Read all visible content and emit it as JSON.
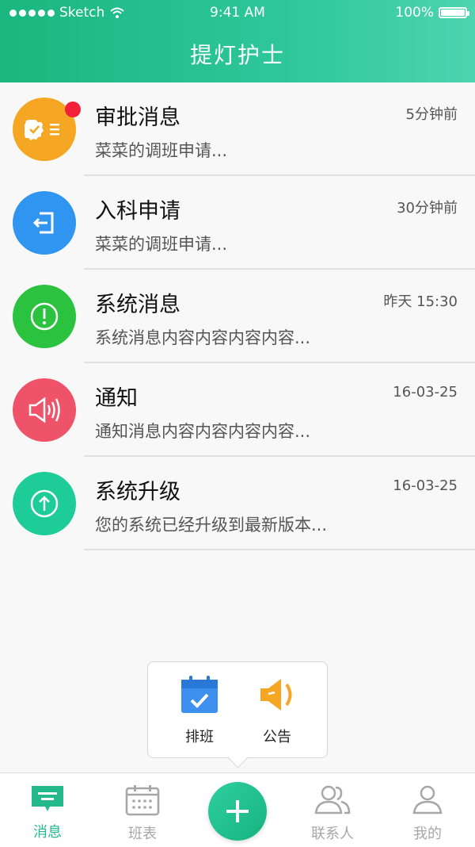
{
  "status_bar": {
    "carrier": "Sketch",
    "time": "9:41 AM",
    "battery": "100%"
  },
  "header": {
    "title": "提灯护士"
  },
  "messages": [
    {
      "name": "审批消息",
      "time": "5分钟前",
      "preview": "菜菜的调班申请...",
      "color": "#f5a623",
      "icon": "approval-icon",
      "unread": true
    },
    {
      "name": "入科申请",
      "time": "30分钟前",
      "preview": "菜菜的调班申请...",
      "color": "#2f95f0",
      "icon": "enter-department-icon",
      "unread": false
    },
    {
      "name": "系统消息",
      "time": "昨天 15:30",
      "preview": "系统消息内容内容内容内容...",
      "color": "#2bc23f",
      "icon": "info-exclamation-icon",
      "unread": false
    },
    {
      "name": "通知",
      "time": "16-03-25",
      "preview": "通知消息内容内容内容内容...",
      "color": "#ef5369",
      "icon": "speaker-icon",
      "unread": false
    },
    {
      "name": "系统升级",
      "time": "16-03-25",
      "preview": "您的系统已经升级到最新版本...",
      "color": "#1dcc96",
      "icon": "upgrade-arrow-icon",
      "unread": false
    }
  ],
  "popup_menu": {
    "items": [
      {
        "label": "排班",
        "icon": "calendar-check-icon",
        "color": "#3d8ff0"
      },
      {
        "label": "公告",
        "icon": "announcement-speaker-icon",
        "color": "#f5a623"
      }
    ]
  },
  "tab_bar": {
    "tabs": [
      {
        "label": "消息",
        "icon": "message-icon",
        "active": true
      },
      {
        "label": "班表",
        "icon": "calendar-icon",
        "active": false
      },
      {
        "label": "联系人",
        "icon": "contacts-icon",
        "active": false
      },
      {
        "label": "我的",
        "icon": "profile-icon",
        "active": false
      }
    ],
    "fab_icon": "plus-icon"
  },
  "colors": {
    "accent": "#23b98a",
    "unread_badge": "#f2213a"
  }
}
